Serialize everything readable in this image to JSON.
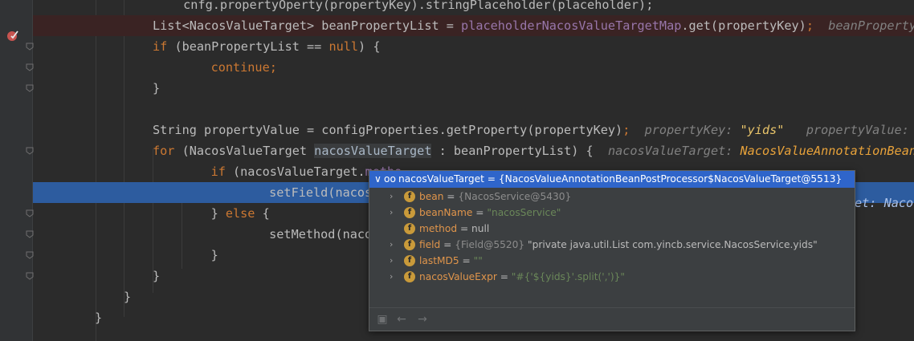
{
  "editor": {
    "lines": [
      {
        "id": "l0",
        "parts": [
          [
            "plain",
            "        cnfg.propertyOperty(propertyKey).stringPlaceholder(placeholder);"
          ]
        ]
      },
      {
        "id": "l1",
        "parts": [
          [
            "plain",
            "List<NacosValueTarget> beanPropertyList = "
          ],
          [
            "fld",
            "placeholderNacosValueTargetMap"
          ],
          [
            "plain",
            ".get(propertyKey)"
          ],
          [
            "kw",
            ";"
          ],
          [
            "inl",
            "  beanPropertyL"
          ]
        ]
      },
      {
        "id": "l2",
        "parts": [
          [
            "kw",
            "if "
          ],
          [
            "plain",
            "(beanPropertyList == "
          ],
          [
            "kw",
            "null"
          ],
          [
            "plain",
            ") {"
          ]
        ]
      },
      {
        "id": "l3",
        "parts": [
          [
            "kw",
            "    continue;"
          ]
        ]
      },
      {
        "id": "l4",
        "parts": [
          [
            "plain",
            "}"
          ]
        ]
      },
      {
        "id": "l5",
        "parts": [
          [
            "plain",
            ""
          ]
        ]
      },
      {
        "id": "l6",
        "parts": [
          [
            "plain",
            "String propertyValue = configProperties.getProperty(propertyKey)"
          ],
          [
            "kw",
            ";"
          ],
          [
            "inl",
            "  propertyKey: "
          ],
          [
            "inls",
            "\"yids\""
          ],
          [
            "inl",
            "   propertyValue:"
          ]
        ]
      },
      {
        "id": "l7",
        "parts": [
          [
            "kw",
            "for "
          ],
          [
            "plain",
            "(NacosValueTarget "
          ],
          [
            "sel",
            "nacosValueTarget"
          ],
          [
            "plain",
            " : beanPropertyList) {"
          ],
          [
            "inl",
            "  nacosValueTarget: "
          ],
          [
            "inlv",
            "NacosValueAnnotationBeanP"
          ]
        ]
      },
      {
        "id": "l8",
        "parts": [
          [
            "kw",
            "    if "
          ],
          [
            "plain",
            "(nacosValueTarget."
          ],
          [
            "fld",
            "metho"
          ]
        ]
      },
      {
        "id": "l9",
        "parts": [
          [
            "plain",
            "        setField(nacosValueTar"
          ]
        ]
      },
      {
        "id": "l10",
        "parts": [
          [
            "plain",
            "    } "
          ],
          [
            "kw",
            "else "
          ],
          [
            "plain",
            "{"
          ]
        ]
      },
      {
        "id": "l11",
        "parts": [
          [
            "plain",
            "        setMethod(nacosValueTa"
          ]
        ]
      },
      {
        "id": "l12",
        "parts": [
          [
            "plain",
            "    }"
          ]
        ]
      },
      {
        "id": "l13",
        "parts": [
          [
            "plain",
            "}"
          ]
        ]
      },
      {
        "id": "l14",
        "parts": [
          [
            "plain",
            "}"
          ]
        ]
      },
      {
        "id": "l15",
        "parts": [
          [
            "plain",
            "}"
          ]
        ]
      }
    ],
    "exec_line_tail": "et: Nacos"
  },
  "popup": {
    "header_arrow": "∨",
    "header_glyph": "oo",
    "header_text": "nacosValueTarget = {NacosValueAnnotationBeanPostProcessor$NacosValueTarget@5513}",
    "rows": [
      {
        "expand": true,
        "name": "bean",
        "eq": " = ",
        "ref": "{NacosService@5430}",
        "val": "",
        "val_type": "plain"
      },
      {
        "expand": true,
        "name": "beanName",
        "eq": " = ",
        "ref": "",
        "val": "\"nacosService\"",
        "val_type": "sv"
      },
      {
        "expand": false,
        "name": "method",
        "eq": " = ",
        "ref": "",
        "val": "null",
        "val_type": "plain"
      },
      {
        "expand": true,
        "name": "field",
        "eq": " = ",
        "ref": "{Field@5520}",
        "val": " \"private java.util.List com.yincb.service.NacosService.yids\"",
        "val_type": "plain"
      },
      {
        "expand": true,
        "name": "lastMD5",
        "eq": " = ",
        "ref": "",
        "val": "\"\"",
        "val_type": "sv"
      },
      {
        "expand": true,
        "name": "nacosValueExpr",
        "eq": " = ",
        "ref": "",
        "val": "\"#{'${yids}'.split(',')}\"",
        "val_type": "sv"
      }
    ],
    "field_icon_letter": "f",
    "chevron": "›",
    "footer": {
      "copy_icon": "▣",
      "back_icon": "←",
      "forward_icon": "→"
    }
  },
  "colors": {
    "exec_line": "#2d5c9f",
    "breakpoint_line": "#3a2323",
    "popup_header": "#2f65ca"
  }
}
